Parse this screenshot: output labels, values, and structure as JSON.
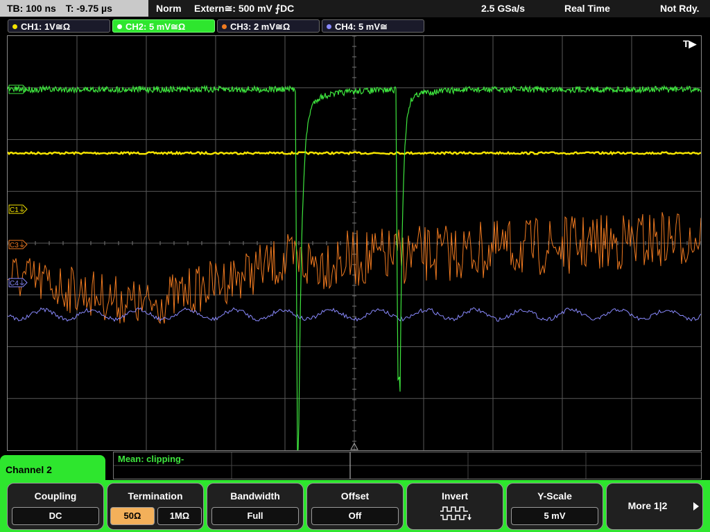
{
  "status": {
    "tb": "TB: 100 ns",
    "t": "T: -9.75 µs",
    "mode": "Norm",
    "trigger": "Extern≅: 500 mV ⨍DC",
    "sample_rate": "2.5 GSa/s",
    "acq": "Real Time",
    "state": "Not Rdy."
  },
  "channels": [
    {
      "label": "CH1: 1V≅Ω",
      "color": "#f5e400",
      "active": false
    },
    {
      "label": "CH2: 5 mV≅Ω",
      "color": "#3ee63e",
      "active": true
    },
    {
      "label": "CH3: 2 mV≅Ω",
      "color": "#f07a20",
      "active": false
    },
    {
      "label": "CH4: 5 mV≅",
      "color": "#8a8aff",
      "active": false
    }
  ],
  "scope": {
    "trigger_marker": "T▶",
    "markers": [
      {
        "label": "C1",
        "color": "#f5e400"
      },
      {
        "label": "C3",
        "color": "#f07a20"
      },
      {
        "label": "C4",
        "color": "#8a8aff"
      }
    ]
  },
  "measurement": "Mean: clipping-",
  "panel": {
    "title": "Channel 2",
    "keys": [
      {
        "title": "Coupling",
        "value": "DC"
      },
      {
        "title": "Termination",
        "options": [
          "50Ω",
          "1MΩ"
        ],
        "selected": 0
      },
      {
        "title": "Bandwidth",
        "value": "Full"
      },
      {
        "title": "Offset",
        "value": "Off"
      },
      {
        "title": "Invert",
        "icon": "invert-waveform-icon"
      },
      {
        "title": "Y-Scale",
        "value": "5 mV"
      },
      {
        "title": "More 1|2",
        "icon": "right-arrow-icon"
      }
    ]
  },
  "colors": {
    "grid": "#5a5a5a",
    "accent": "#2ee62e"
  }
}
